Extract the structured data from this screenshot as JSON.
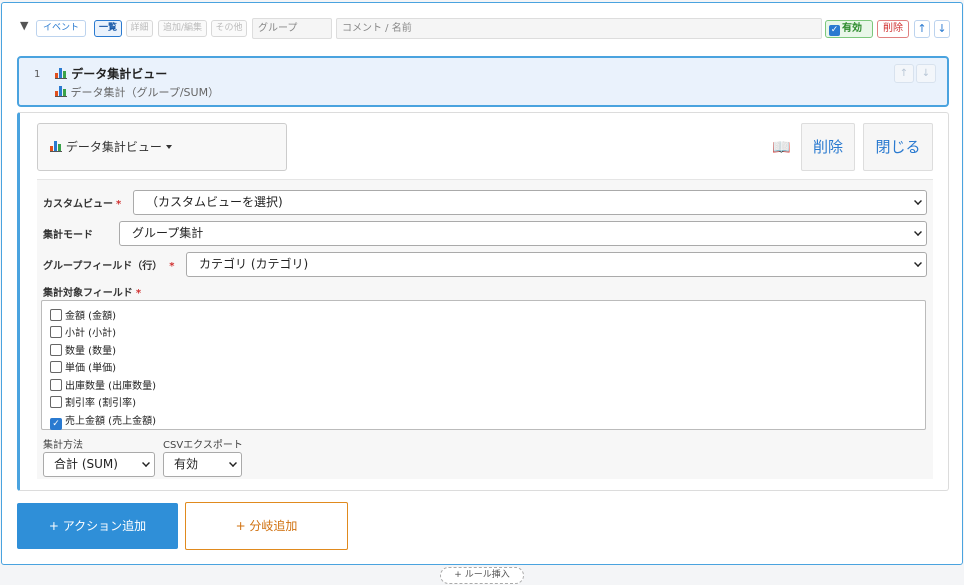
{
  "toolbar": {
    "collapse_glyph": "▼",
    "tags": {
      "event": "イベント",
      "list": "一覧",
      "detail": "詳細",
      "add_edit": "追加/編集",
      "other": "その他"
    },
    "group_placeholder": "グループ",
    "comment_placeholder": "コメント / 名前",
    "enabled_label": "有効",
    "enabled_checked": true,
    "delete_label": "削除",
    "up_glyph": "↑",
    "down_glyph": "↓"
  },
  "step": {
    "number": "1",
    "title": "データ集計ビュー",
    "subtitle": "データ集計（グループ/SUM）",
    "up_glyph": "↑",
    "down_glyph": "↓"
  },
  "editor": {
    "type_label": "データ集計ビュー",
    "delete_label": "削除",
    "close_label": "閉じる",
    "fields": {
      "custom_view": {
        "label": "カスタムビュー",
        "required": "*",
        "value": "（カスタムビューを選択)"
      },
      "mode": {
        "label": "集計モード",
        "value": "グループ集計"
      },
      "group_field": {
        "label": "グループフィールド（行）",
        "required": "*",
        "value": "カテゴリ (カテゴリ)"
      },
      "target_fields": {
        "label": "集計対象フィールド",
        "required": "*",
        "options": [
          {
            "label": "金額 (金額)",
            "checked": false
          },
          {
            "label": "小計 (小計)",
            "checked": false
          },
          {
            "label": "数量 (数量)",
            "checked": false
          },
          {
            "label": "単価 (単価)",
            "checked": false
          },
          {
            "label": "出庫数量 (出庫数量)",
            "checked": false
          },
          {
            "label": "割引率 (割引率)",
            "checked": false
          },
          {
            "label": "売上金額 (売上金額)",
            "checked": true
          }
        ]
      },
      "method": {
        "label": "集計方法",
        "value": "合計 (SUM)"
      },
      "csv_export": {
        "label": "CSVエクスポート",
        "value": "有効"
      }
    }
  },
  "footer": {
    "add_action": "+ アクション追加",
    "add_branch": "+ 分岐追加",
    "insert_rule": "+ ルール挿入"
  },
  "colors": {
    "accent": "#2f8fd8",
    "selected_bg": "#eaf2fc",
    "danger": "#d03030",
    "branch": "#e08a1e",
    "success": "#2b8a2b"
  }
}
